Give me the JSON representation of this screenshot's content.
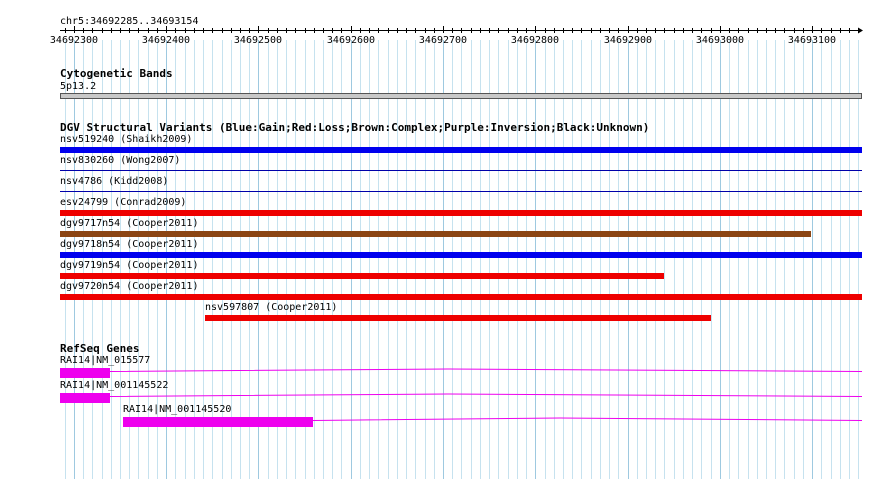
{
  "location": "chr5:34692285..34693154",
  "ruler": {
    "start": 34692285,
    "end": 34693154,
    "ticks": [
      "34692300",
      "34692400",
      "34692500",
      "34692600",
      "34692700",
      "34692800",
      "34692900",
      "34693000",
      "34693100"
    ]
  },
  "tracks": {
    "cytoband": {
      "title": "Cytogenetic Bands",
      "band_label": "5p13.2",
      "color": "#c8c8c8"
    },
    "dgv": {
      "title": "DGV Structural Variants (Blue:Gain;Red:Loss;Brown:Complex;Purple:Inversion;Black:Unknown)",
      "features": [
        {
          "label": "nsv519240 (Shaikh2009)",
          "start": 34692285,
          "end": 34693154,
          "color": "#0000ee",
          "style": "thick"
        },
        {
          "label": "nsv830260 (Wong2007)",
          "start": 34692285,
          "end": 34693154,
          "color": "#0000aa",
          "style": "thin"
        },
        {
          "label": "nsv4786 (Kidd2008)",
          "start": 34692285,
          "end": 34693154,
          "color": "#0000aa",
          "style": "thin"
        },
        {
          "label": "esv24799 (Conrad2009)",
          "start": 34692285,
          "end": 34693154,
          "color": "#ee0000",
          "style": "thick"
        },
        {
          "label": "dgv9717n54 (Cooper2011)",
          "start": 34692285,
          "end": 34693099,
          "color": "#8b4513",
          "style": "thick"
        },
        {
          "label": "dgv9718n54 (Cooper2011)",
          "start": 34692285,
          "end": 34693154,
          "color": "#0000ee",
          "style": "thick"
        },
        {
          "label": "dgv9719n54 (Cooper2011)",
          "start": 34692285,
          "end": 34692939,
          "color": "#ee0000",
          "style": "thick"
        },
        {
          "label": "dgv9720n54 (Cooper2011)",
          "start": 34692285,
          "end": 34693154,
          "color": "#ee0000",
          "style": "thick"
        },
        {
          "label": "nsv597807 (Cooper2011)",
          "start": 34692442,
          "end": 34692990,
          "color": "#ee0000",
          "style": "thick"
        }
      ]
    },
    "refseq": {
      "title": "RefSeq Genes",
      "color": "#ee00ee",
      "genes": [
        {
          "label": "RAI14|NM_015577",
          "exon_start": 34692285,
          "exon_end": 34692339,
          "intron_end": 34693154
        },
        {
          "label": "RAI14|NM_001145522",
          "exon_start": 34692285,
          "exon_end": 34692339,
          "intron_end": 34693154
        },
        {
          "label": "RAI14|NM_001145520",
          "exon_start": 34692353,
          "exon_end": 34692559,
          "intron_end": 34693154
        }
      ]
    }
  }
}
